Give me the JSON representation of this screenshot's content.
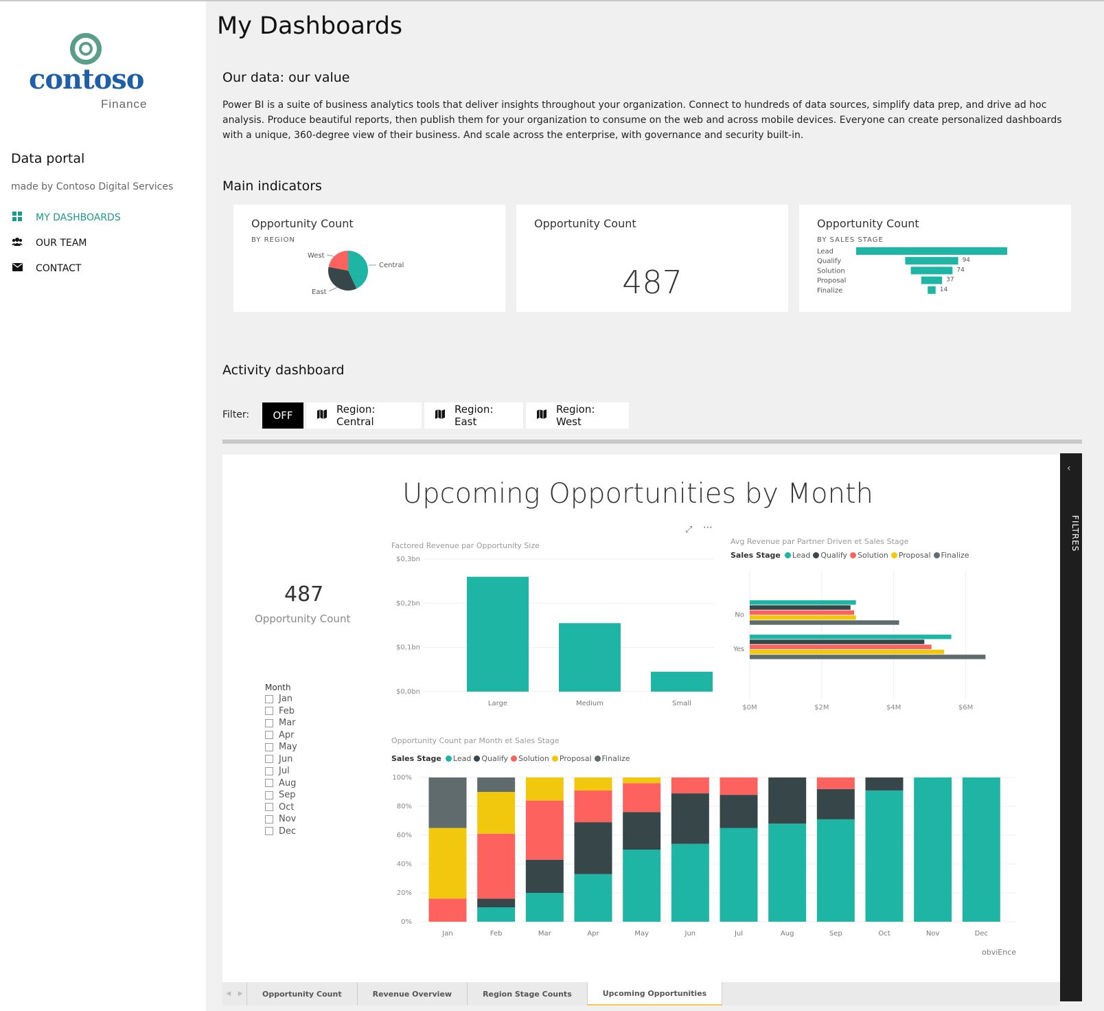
{
  "sidebar": {
    "logo_word": "contoso",
    "logo_sub": "Finance",
    "portal_title": "Data portal",
    "portal_sub": "made by Contoso Digital Services",
    "nav": [
      {
        "label": "MY DASHBOARDS",
        "icon": "grid-icon"
      },
      {
        "label": "OUR TEAM",
        "icon": "users-icon"
      },
      {
        "label": "CONTACT",
        "icon": "envelope-icon"
      }
    ]
  },
  "main": {
    "title": "My Dashboards",
    "section1": "Our data: our value",
    "paragraph": "Power BI is a suite of business analytics tools that deliver insights throughout your organization. Connect to hundreds of data sources, simplify data prep, and drive ad hoc analysis. Produce beautiful reports, then publish them for your organization to consume on the web and across mobile devices. Everyone can create personalized dashboards with a unique, 360-degree view of their business. And scale across the enterprise, with governance and security built-in.",
    "section2": "Main indicators",
    "section3": "Activity dashboard"
  },
  "cards": [
    {
      "title": "Opportunity Count",
      "subtitle": "BY REGION"
    },
    {
      "title": "Opportunity Count",
      "value": "487"
    },
    {
      "title": "Opportunity Count",
      "subtitle": "BY SALES STAGE"
    }
  ],
  "filter": {
    "label": "Filter:",
    "buttons": [
      "OFF",
      "Region: Central",
      "Region: East",
      "Region: West"
    ]
  },
  "report": {
    "title": "Upcoming Opportunities by Month",
    "kpi_value": "487",
    "kpi_label": "Opportunity Count",
    "month_title": "Month",
    "months": [
      "Jan",
      "Feb",
      "Mar",
      "Apr",
      "May",
      "Jun",
      "Jul",
      "Aug",
      "Sep",
      "Oct",
      "Nov",
      "Dec"
    ],
    "filters_label": "FILTRES",
    "watermark": "obviEnce",
    "tabs": [
      "Opportunity Count",
      "Revenue Overview",
      "Region Stage Counts",
      "Upcoming Opportunities"
    ],
    "active_tab": "Upcoming Opportunities",
    "chart1_title": "Factored Revenue par Opportunity Size",
    "chart2_title": "Avg Revenue par Partner Driven et Sales Stage",
    "chart3_title": "Opportunity Count par Month et Sales Stage",
    "legend_title": "Sales Stage"
  },
  "colors": {
    "teal": "#1fb5a5",
    "dark": "#374649",
    "red": "#fd625e",
    "yellow": "#f2c80f",
    "gray": "#5f6b6d",
    "accent": "#1a9a8a"
  },
  "chart_data": [
    {
      "type": "pie",
      "subtitle": "BY REGION",
      "categories": [
        "Central",
        "East",
        "West"
      ],
      "values": [
        43,
        35,
        22
      ]
    },
    {
      "type": "bar",
      "orientation": "horizontal",
      "subtitle": "BY SALES STAGE",
      "categories": [
        "Lead",
        "Qualify",
        "Solution",
        "Proposal",
        "Finalize"
      ],
      "values": [
        268,
        94,
        74,
        37,
        14
      ],
      "data_labels": [
        "",
        "94",
        "74",
        "37",
        "14"
      ]
    },
    {
      "type": "bar",
      "title": "Factored Revenue par Opportunity Size",
      "categories": [
        "Large",
        "Medium",
        "Small"
      ],
      "values": [
        0.26,
        0.155,
        0.045
      ],
      "ylim": [
        0,
        0.3
      ],
      "yticks": [
        "$0,0bn",
        "$0,1bn",
        "$0,2bn",
        "$0,3bn"
      ],
      "grid": true
    },
    {
      "type": "bar",
      "orientation": "horizontal",
      "title": "Avg Revenue par Partner Driven et Sales Stage",
      "categories": [
        "No",
        "Yes"
      ],
      "series": [
        {
          "name": "Lead",
          "values": [
            2.95,
            5.6
          ]
        },
        {
          "name": "Qualify",
          "values": [
            2.8,
            4.85
          ]
        },
        {
          "name": "Solution",
          "values": [
            2.9,
            5.05
          ]
        },
        {
          "name": "Proposal",
          "values": [
            2.95,
            5.4
          ]
        },
        {
          "name": "Finalize",
          "values": [
            4.15,
            6.55
          ]
        }
      ],
      "xlim": [
        0,
        7
      ],
      "xticks": [
        "$0M",
        "$2M",
        "$4M",
        "$6M"
      ],
      "legend": "top-left"
    },
    {
      "type": "bar",
      "stacked": "percent",
      "title": "Opportunity Count par Month et Sales Stage",
      "categories": [
        "Jan",
        "Feb",
        "Mar",
        "Apr",
        "May",
        "Jun",
        "Jul",
        "Aug",
        "Sep",
        "Oct",
        "Nov",
        "Dec"
      ],
      "series": [
        {
          "name": "Lead",
          "values": [
            0,
            10,
            20,
            33,
            50,
            54,
            65,
            68,
            71,
            91,
            100,
            100
          ]
        },
        {
          "name": "Qualify",
          "values": [
            0,
            6,
            23,
            36,
            26,
            35,
            23,
            32,
            21,
            9,
            0,
            0
          ]
        },
        {
          "name": "Solution",
          "values": [
            16,
            45,
            41,
            22,
            20,
            11,
            12,
            0,
            8,
            0,
            0,
            0
          ]
        },
        {
          "name": "Proposal",
          "values": [
            49,
            29,
            16,
            9,
            4,
            0,
            0,
            0,
            0,
            0,
            0,
            0
          ]
        },
        {
          "name": "Finalize",
          "values": [
            35,
            10,
            0,
            0,
            0,
            0,
            0,
            0,
            0,
            0,
            0,
            0
          ]
        }
      ],
      "ylim": [
        0,
        100
      ],
      "yticks": [
        "0%",
        "20%",
        "40%",
        "60%",
        "80%",
        "100%"
      ],
      "legend": "top-left"
    }
  ]
}
